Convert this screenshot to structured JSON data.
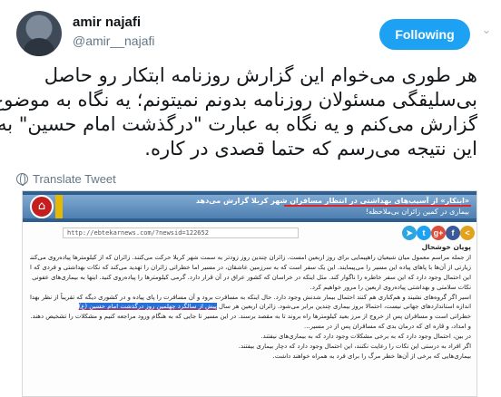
{
  "tweet": {
    "display_name": "amir najafi",
    "handle": "@amir__najafi",
    "follow_label": "Following",
    "text_lines": [
      "هر طوری می‌خوام این گزارش روزنامه ابتکار رو حاصل",
      "بی‌سلیقگی مسئولان روزنامه بدونم نمیتونم؛ یه نگاه به موضوع",
      "گزارش می‌کنم و یه نگاه به عبارت \"درگذشت امام حسین\" به",
      "این نتیجه می‌رسم که حتما قصدی در کاره."
    ],
    "translate_label": "Translate Tweet",
    "colors": {
      "accent": "#1da1f2",
      "muted": "#657786"
    }
  },
  "embed": {
    "banner_line1": "«ابتکار» از آسیب‌های بهداشتی در انتظار مسافران شهر کربلا گزارش می‌دهد",
    "banner_line2": "بیماری در کمین زائران بی‌ملاحظه!",
    "url": "http://ebtekarnews.com/?newsid=122652",
    "share_icons": [
      {
        "name": "telegram-icon",
        "glyph": "➤",
        "color": "#2ca5e0"
      },
      {
        "name": "twitter-icon",
        "glyph": "t",
        "color": "#1da1f2"
      },
      {
        "name": "googleplus-icon",
        "glyph": "g+",
        "color": "#dd4b39"
      },
      {
        "name": "facebook-icon",
        "glyph": "f",
        "color": "#3b5998"
      },
      {
        "name": "share-icon",
        "glyph": "<",
        "color": "#e2a21a"
      }
    ],
    "subheading": "پویان خوشحال",
    "paragraph_lines": [
      "از جمله مراسم معمول میان شیعیان راهپیمایی برای روز اربعین امست. زائران چندین روز زودتر به سمت شهر کربلا حرکت می‌کنند. زائران که از کیلومترها پیاده‌روی می‌کنند تا اهدای",
      "زیارتی از آن‌ها با پاهای پیاده این مسیر را می‌پیمایند. این یک سفر است که به سرزمین عاشقان، در مسیر اما خطراتی زائران را تهدید می‌کند که نکات بهداشتی و فردی که اگر رعایت نشود،",
      "این احتمال وجود دارد که این سفر خاطره را ناگوار کند. مثل اینکه در خراسان که کشور عراق در آن قرار دارد. گرمی کیلومترها را پیاده‌روی کنید. اینها به بیماری‌های عفونی منجر می‌شود. در گزارش پیش‌رو",
      "نکات سلامتی و بهداشتی پیاده‌روی اربعین را مرور خواهیم کرد.",
      "اسیر اگر گروه‌های نشیند و هم‌کناری هم کنند احتمال بیمار شدنش وجود دارد. حال اینکه به مسافرت برود و آن مسافرت را پای پیاده و در کشوری دیگه که تقریباً از نظر بهداشتی به",
      "اندازه استانداردهای جهانی نیست، احتمالا بروز بیماری چندین برابر می‌شود. زائران اربعین هر سال",
      "خطراتی است و مسافران پس از خروج از مرز بعید کیلومترها راه بروند تا به مقصد برسند. در این مسیر تا جایی که به هنگام ورود مراجعه کنیم و مشکلات را تشخیص دهند.",
      "و امداد، و قاره ای که درمان بدی که مسافران پس از در مسیر...",
      "در بین، احتمال وجود دارد که به برخی مشکلات وجود دارد که به بیماری‌های نیفتند.",
      "اگر افراد به درستی این نکات را رعایت نکنند، این احتمال وجود دارد که دچار بیماری بیفتند.",
      "بیماری‌هایی که برخی از آن‌ها خطر مرگ را برای فرد به همراه خواهند داشت."
    ],
    "highlighted_text": "پیش از سالگرد چهلمین روز درگذشت امام حسین (ع)",
    "colors": {
      "banner": "#4f80b2",
      "highlight": "#2a6fd6",
      "underline": "#e0232b",
      "home": "#c41e1e"
    }
  }
}
